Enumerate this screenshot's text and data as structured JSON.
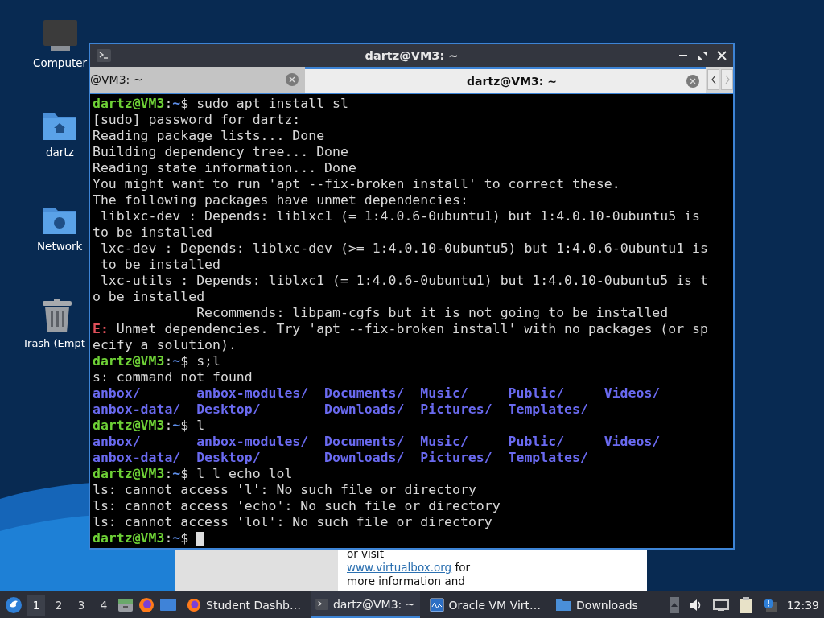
{
  "desktop_icons": [
    {
      "kind": "computer",
      "label": "Computer"
    },
    {
      "kind": "home",
      "label": "dartz"
    },
    {
      "kind": "network",
      "label": "Network"
    },
    {
      "kind": "trash",
      "label": "Trash (Empt"
    }
  ],
  "background_window": {
    "lines": [
      {
        "text": "or visit"
      },
      {
        "link": "www.virtualbox.org",
        "text": "for"
      },
      {
        "text": "more information and"
      }
    ]
  },
  "terminal_window": {
    "title": "dartz@VM3: ~",
    "tabs": [
      {
        "label": "@VM3: ~",
        "selected": false
      },
      {
        "label": "dartz@VM3: ~",
        "selected": true
      }
    ],
    "lines": [
      {
        "kind": "prompt",
        "user": "dartz@VM3",
        "sep": ":",
        "path": "~",
        "command": "$ sudo apt install sl",
        "cursor": false
      },
      {
        "kind": "text",
        "text": "[sudo] password for dartz:"
      },
      {
        "kind": "text",
        "text": "Reading package lists... Done"
      },
      {
        "kind": "text",
        "text": "Building dependency tree... Done"
      },
      {
        "kind": "text",
        "text": "Reading state information... Done"
      },
      {
        "kind": "text",
        "text": "You might want to run 'apt --fix-broken install' to correct these."
      },
      {
        "kind": "text",
        "text": "The following packages have unmet dependencies:"
      },
      {
        "kind": "text",
        "text": " liblxc-dev : Depends: liblxc1 (= 1:4.0.6-0ubuntu1) but 1:4.0.10-0ubuntu5 is"
      },
      {
        "kind": "text",
        "text": "to be installed"
      },
      {
        "kind": "text",
        "text": " lxc-dev : Depends: liblxc-dev (>= 1:4.0.10-0ubuntu5) but 1:4.0.6-0ubuntu1 is"
      },
      {
        "kind": "text",
        "text": " to be installed"
      },
      {
        "kind": "text",
        "text": " lxc-utils : Depends: liblxc1 (= 1:4.0.6-0ubuntu1) but 1:4.0.10-0ubuntu5 is t"
      },
      {
        "kind": "text",
        "text": "o be installed"
      },
      {
        "kind": "text",
        "text": "             Recommends: libpam-cgfs but it is not going to be installed"
      },
      {
        "kind": "error",
        "label": "E:",
        "text": "Unmet dependencies. Try 'apt --fix-broken install' with no packages (or sp"
      },
      {
        "kind": "text",
        "text": "ecify a solution)."
      },
      {
        "kind": "prompt",
        "user": "dartz@VM3",
        "sep": ":",
        "path": "~",
        "command": "$ s;l",
        "cursor": false
      },
      {
        "kind": "text",
        "text": "s: command not found"
      },
      {
        "kind": "dirs",
        "entries": [
          "anbox/",
          "anbox-modules/",
          "Documents/",
          "Music/",
          "Public/",
          "Videos/"
        ]
      },
      {
        "kind": "dirs",
        "entries": [
          "anbox-data/",
          "Desktop/",
          "Downloads/",
          "Pictures/",
          "Templates/"
        ]
      },
      {
        "kind": "prompt",
        "user": "dartz@VM3",
        "sep": ":",
        "path": "~",
        "command": "$ l",
        "cursor": false
      },
      {
        "kind": "dirs",
        "entries": [
          "anbox/",
          "anbox-modules/",
          "Documents/",
          "Music/",
          "Public/",
          "Videos/"
        ]
      },
      {
        "kind": "dirs",
        "entries": [
          "anbox-data/",
          "Desktop/",
          "Downloads/",
          "Pictures/",
          "Templates/"
        ]
      },
      {
        "kind": "prompt",
        "user": "dartz@VM3",
        "sep": ":",
        "path": "~",
        "command": "$ l l echo lol",
        "cursor": false
      },
      {
        "kind": "text",
        "text": "ls: cannot access 'l': No such file or directory"
      },
      {
        "kind": "text",
        "text": "ls: cannot access 'echo': No such file or directory"
      },
      {
        "kind": "text",
        "text": "ls: cannot access 'lol': No such file or directory"
      },
      {
        "kind": "prompt",
        "user": "dartz@VM3",
        "sep": ":",
        "path": "~",
        "command": "$",
        "cursor": true
      }
    ]
  },
  "taskbar": {
    "workspaces": [
      {
        "label": "1",
        "selected": true
      },
      {
        "label": "2",
        "selected": false
      },
      {
        "label": "3",
        "selected": false
      },
      {
        "label": "4",
        "selected": false
      }
    ],
    "tasks": [
      {
        "kind": "browser",
        "label": "Student Dashb…",
        "selected": false
      },
      {
        "kind": "terminal",
        "label": "dartz@VM3: ~",
        "selected": true
      },
      {
        "kind": "monitor",
        "label": "Oracle VM Virt…",
        "selected": false
      },
      {
        "kind": "folder",
        "label": "Downloads",
        "selected": false
      }
    ],
    "clock": "12:39"
  }
}
